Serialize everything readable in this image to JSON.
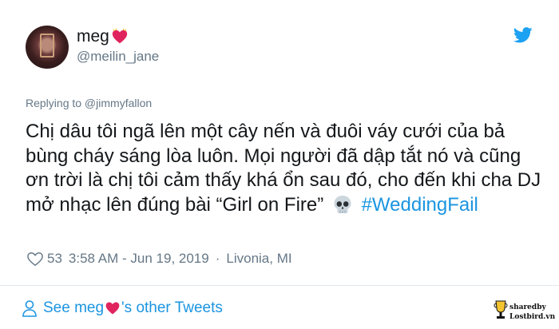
{
  "author": {
    "name": "meg",
    "name_emoji": "red-heart-emoji",
    "handle": "@meilin_jane"
  },
  "reply_to": "Replying to @jimmyfallon",
  "tweet": {
    "text": "Chị dâu tôi ngã lên một cây nến và đuôi váy cưới của bả bùng cháy sáng lòa luôn. Mọi người đã dập tắt nó và cũng ơn trời là chị tôi cảm thấy khá ổn sau đó, cho đến khi cha DJ mở nhạc lên đúng bài “Girl on Fire”",
    "emoji": "skull-emoji",
    "hashtag": "#WeddingFail"
  },
  "meta": {
    "likes": "53",
    "timestamp": "3:58 AM - Jun 19, 2019",
    "separator": "·",
    "location": "Livonia, MI"
  },
  "footer": {
    "see_prefix": "See meg",
    "see_suffix": "'s other Tweets"
  },
  "watermark": {
    "line1": "sharedby",
    "line2": "Lostbird.vn"
  },
  "colors": {
    "link": "#1b95e0",
    "secondary_text": "#657786",
    "primary_text": "#14171a",
    "heart": "#e0245e",
    "twitter_blue": "#1da1f2"
  }
}
